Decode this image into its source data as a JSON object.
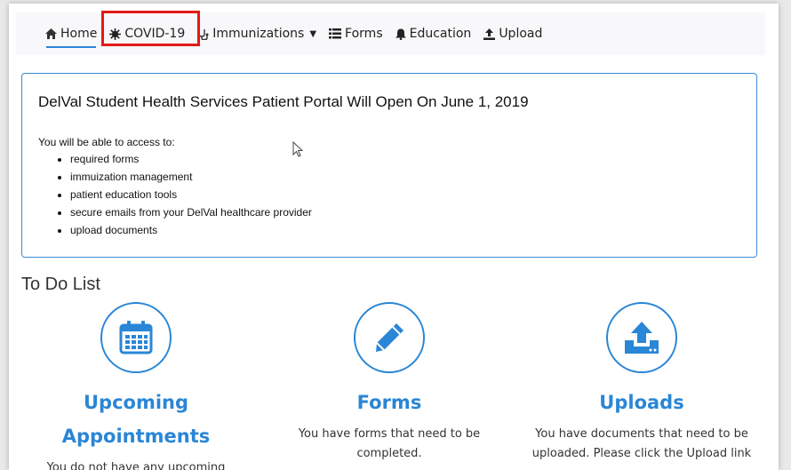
{
  "nav": {
    "items": [
      {
        "label": "Home",
        "icon": "home-icon"
      },
      {
        "label": "COVID-19",
        "icon": "virus-icon"
      },
      {
        "label": "Immunizations",
        "icon": "stethoscope-icon"
      },
      {
        "label": "Forms",
        "icon": "list-icon"
      },
      {
        "label": "Education",
        "icon": "bell-icon"
      },
      {
        "label": "Upload",
        "icon": "upload-icon"
      }
    ]
  },
  "notice": {
    "title": "DelVal Student Health Services Patient Portal Will Open On June 1, 2019",
    "intro": "You will be able to access to:",
    "bullets": [
      "required forms",
      "immuization management",
      "patient education tools",
      "secure emails from your DelVal healthcare provider",
      "upload documents"
    ]
  },
  "todo": {
    "title": "To Do List",
    "cards": [
      {
        "title": "Upcoming Appointments",
        "text": "You do not have any upcoming"
      },
      {
        "title": "Forms",
        "text": "You have forms that need to be completed."
      },
      {
        "title": "Uploads",
        "text": "You have documents that need to be uploaded. Please click the Upload link"
      }
    ]
  },
  "colors": {
    "accent": "#2a86d6",
    "highlight": "#e31919",
    "nav_bg": "#f8f8fa"
  }
}
